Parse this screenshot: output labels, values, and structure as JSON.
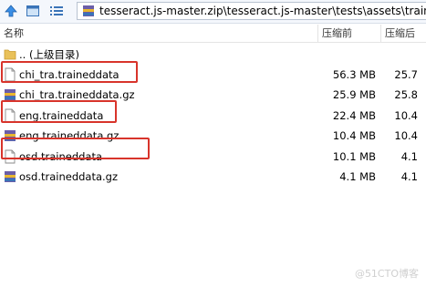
{
  "path": {
    "text": "tesseract.js-master.zip\\tesseract.js-master\\tests\\assets\\traine"
  },
  "columns": {
    "name": "名称",
    "size": "压缩前",
    "packed": "压缩后"
  },
  "rows": [
    {
      "name": ".. (上级目录)",
      "size": "",
      "packed": "",
      "icon": "folder-icon"
    },
    {
      "name": "chi_tra.traineddata",
      "size": "56.3 MB",
      "packed": "25.7",
      "icon": "file-icon"
    },
    {
      "name": "chi_tra.traineddata.gz",
      "size": "25.9 MB",
      "packed": "25.8",
      "icon": "archive-icon"
    },
    {
      "name": "eng.traineddata",
      "size": "22.4 MB",
      "packed": "10.4",
      "icon": "file-icon"
    },
    {
      "name": "eng.traineddata.gz",
      "size": "10.4 MB",
      "packed": "10.4",
      "icon": "archive-icon"
    },
    {
      "name": "osd.traineddata",
      "size": "10.1 MB",
      "packed": "4.1",
      "icon": "file-icon"
    },
    {
      "name": "osd.traineddata.gz",
      "size": "4.1 MB",
      "packed": "4.1",
      "icon": "archive-icon"
    }
  ],
  "watermark": "@51CTO博客",
  "colors": {
    "highlight": "#d8342b",
    "folder": "#e9c15a"
  }
}
